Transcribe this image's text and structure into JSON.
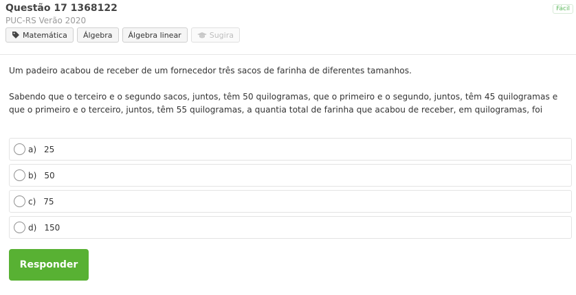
{
  "question": {
    "title": "Questão 17 1368122",
    "source": "PUC-RS Verão 2020",
    "difficulty": "Fácil",
    "tags": [
      "Matemática",
      "Álgebra",
      "Álgebra linear"
    ],
    "suggest_label": "Sugira",
    "paragraphs": [
      "Um padeiro acabou de receber de um fornecedor três sacos de farinha de diferentes tamanhos.",
      "Sabendo que o terceiro e o segundo sacos, juntos, têm 50 quilogramas, que o primeiro e o segundo, juntos, têm 45 quilogramas e que o primeiro e o terceiro, juntos, têm 55 quilogramas, a quantia total de farinha que acabou de receber, em quilogramas, foi"
    ],
    "options": [
      {
        "letter": "a)",
        "value": "25"
      },
      {
        "letter": "b)",
        "value": "50"
      },
      {
        "letter": "c)",
        "value": "75"
      },
      {
        "letter": "d)",
        "value": "150"
      }
    ],
    "submit_label": "Responder"
  },
  "colors": {
    "submit": "#58b133",
    "difficulty": "#5cb85c"
  }
}
